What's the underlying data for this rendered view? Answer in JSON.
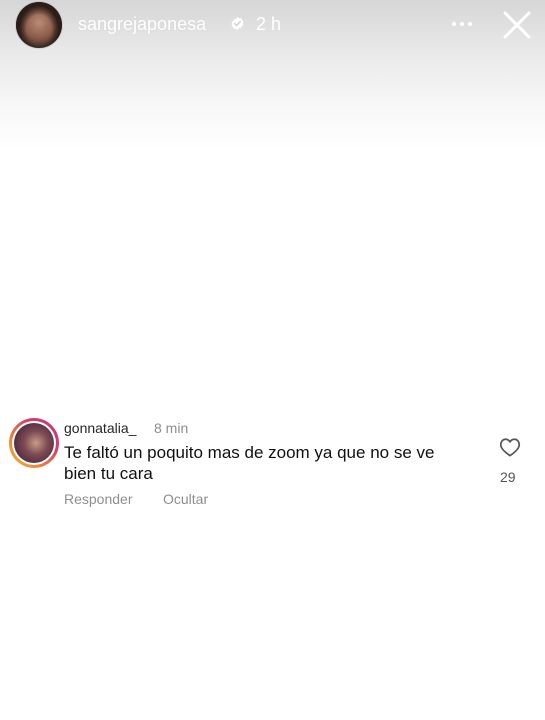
{
  "story": {
    "username": "sangrejaponesa",
    "time_ago": "2 h"
  },
  "comment": {
    "username": "gonnatalia_",
    "time_ago": "8 min",
    "text": "Te faltó un poquito mas de zoom ya que no se ve bien tu cara",
    "reply_label": "Responder",
    "hide_label": "Ocultar",
    "like_count": "29"
  },
  "colors": {
    "header_text": "#ffffff",
    "secondary_text": "#8e8e8e",
    "ring_gradient": [
      "#f9b43a",
      "#d63d6a",
      "#c13584"
    ]
  },
  "icons": [
    "verified-badge-icon",
    "more-options-icon",
    "close-icon",
    "heart-icon"
  ]
}
